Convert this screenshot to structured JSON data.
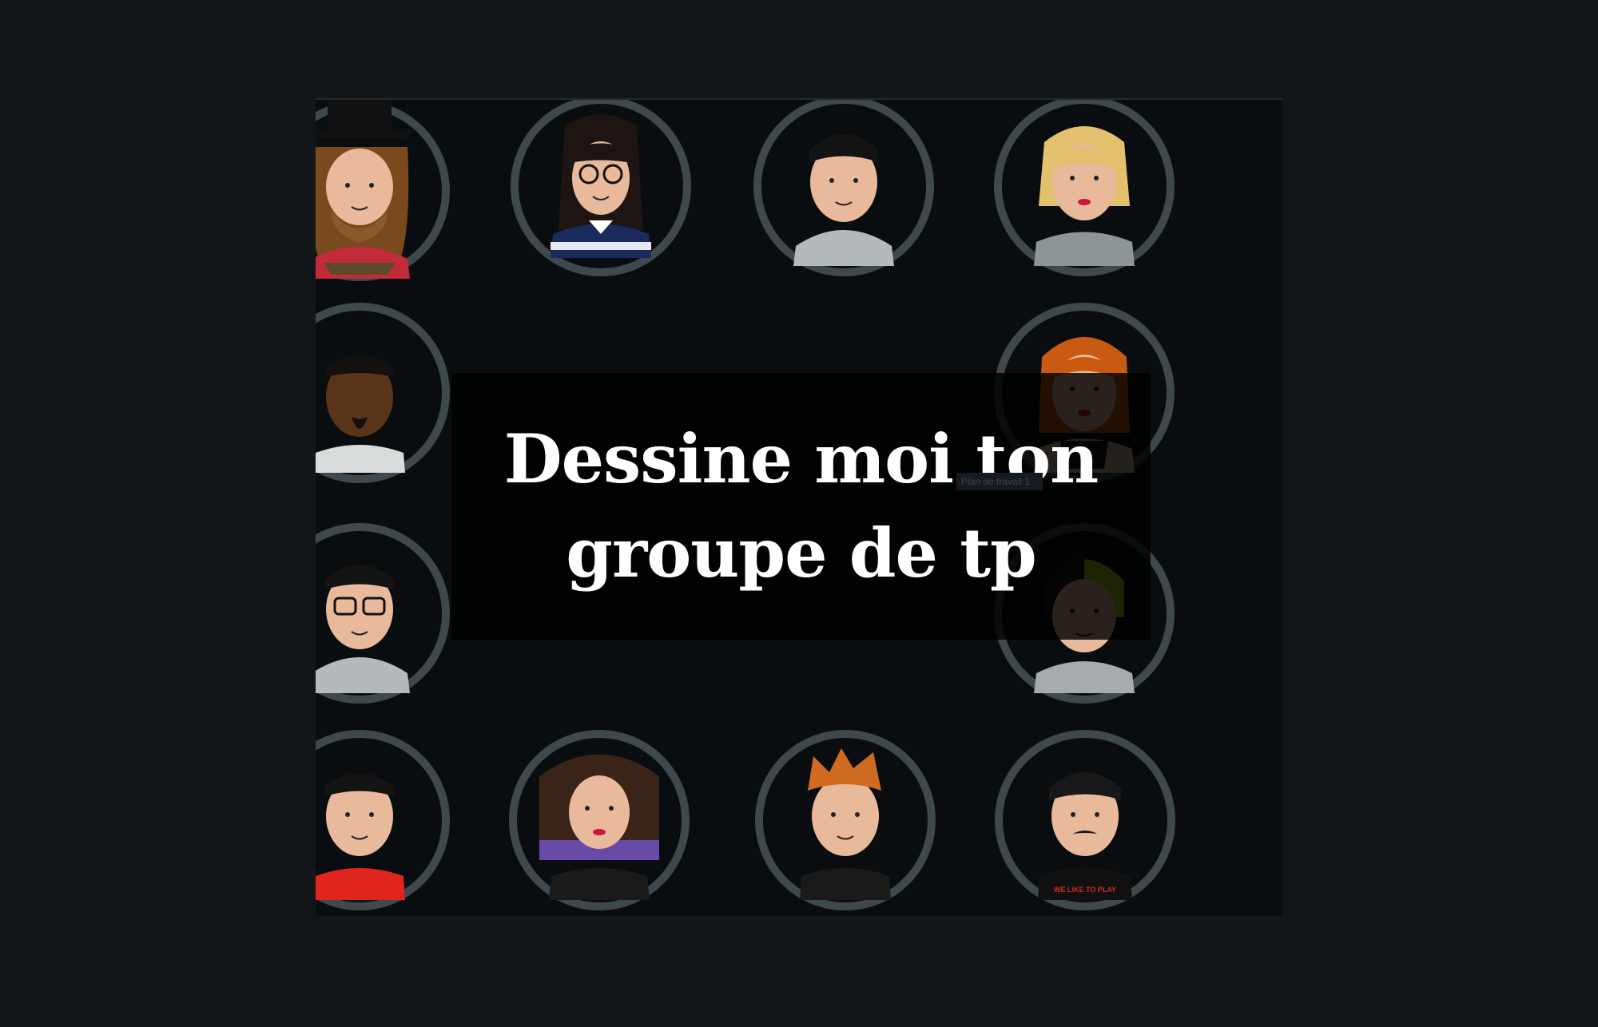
{
  "title": {
    "line1": "Dessine moi ton",
    "line2": "groupe de tp"
  },
  "artboard_label": "Plan de travail 1",
  "colors": {
    "background": "#121619",
    "artboard": "#0a0d10",
    "ring": "#3f484c",
    "skin": "#e9b99c",
    "title_text": "#ffffff"
  },
  "avatars": [
    {
      "id": "hat-bearded-man",
      "hair": "#7a4a1e",
      "top": "#c22b3a"
    },
    {
      "id": "glasses-long-dark-hair",
      "hair": "#1e1412",
      "top": "#1b2a5c"
    },
    {
      "id": "short-dark-hair-hoodie",
      "hair": "#141414",
      "top": "#b4b9bb"
    },
    {
      "id": "blonde-woman",
      "hair": "#e2c06e",
      "top": "#8e9598"
    },
    {
      "id": "dark-skin-goatee",
      "hair": "#141010",
      "top": "#d8dcdd"
    },
    {
      "id": "red-haired-woman",
      "hair": "#c95a12",
      "top": "#1a1a1a"
    },
    {
      "id": "glasses-man-hoodie",
      "hair": "#141414",
      "top": "#b4b9bb"
    },
    {
      "id": "green-black-hair",
      "hair": "#a8c814",
      "top": "#a6acae"
    },
    {
      "id": "dark-hair-red-shirt",
      "hair": "#141414",
      "top": "#e0251e"
    },
    {
      "id": "curly-hair-woman",
      "hair": "#3a2418",
      "top": "#6a4aa8"
    },
    {
      "id": "ginger-spiky-hair",
      "hair": "#cf6a20",
      "top": "#1a1a1a"
    },
    {
      "id": "mustache-man",
      "hair": "#181818",
      "top": "#111111",
      "shirt_text": "WE LIKE TO PLAY"
    }
  ]
}
